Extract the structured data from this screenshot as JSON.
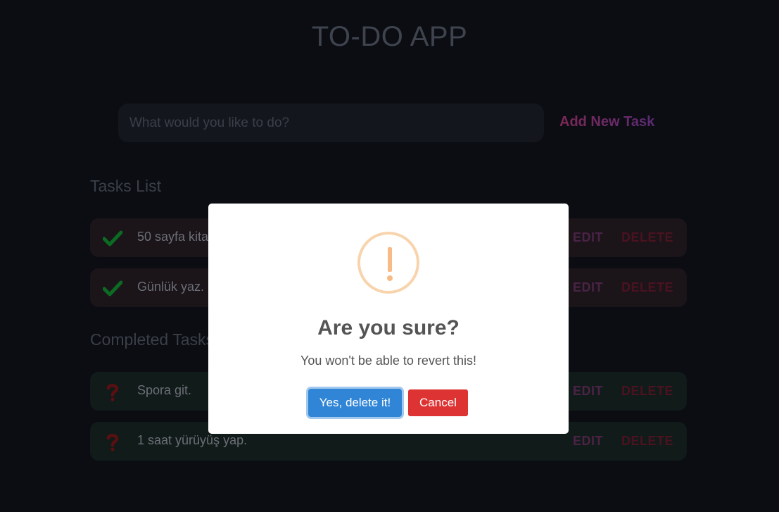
{
  "app": {
    "title": "TO-DO APP"
  },
  "new_task": {
    "placeholder": "What would you like to do?",
    "add_label": "Add New Task"
  },
  "sections": {
    "tasks_title": "Tasks List",
    "completed_title": "Completed Tasks"
  },
  "tasks": [
    {
      "text": "50 sayfa kitap oku.",
      "icon": "check-icon",
      "edit": "EDIT",
      "delete": "DELETE"
    },
    {
      "text": "Günlük yaz.",
      "icon": "check-icon",
      "edit": "EDIT",
      "delete": "DELETE"
    }
  ],
  "completed": [
    {
      "text": "Spora git.",
      "icon": "question-icon",
      "edit": "EDIT",
      "delete": "DELETE"
    },
    {
      "text": "1 saat yürüyüş yap.",
      "icon": "question-icon",
      "edit": "EDIT",
      "delete": "DELETE"
    }
  ],
  "dialog": {
    "icon": "warning-icon",
    "title": "Are you sure?",
    "text": "You won't be able to revert this!",
    "confirm_label": "Yes, delete it!",
    "cancel_label": "Cancel"
  },
  "colors": {
    "background": "#0b0d13",
    "confirm": "#3085d6",
    "cancel": "#dd3333",
    "warning": "#f8bb86"
  }
}
